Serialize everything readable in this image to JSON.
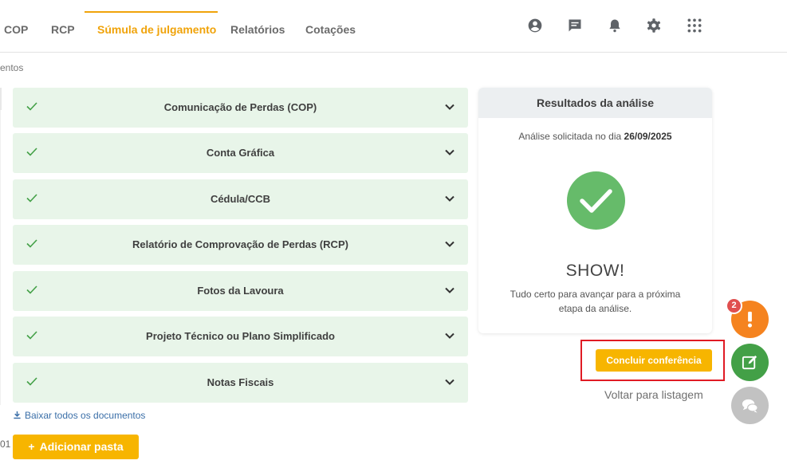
{
  "nav": {
    "tabs": [
      {
        "label": "COP"
      },
      {
        "label": "RCP"
      },
      {
        "label": "Súmula de julgamento",
        "active": true
      },
      {
        "label": "Relatórios"
      },
      {
        "label": "Cotações"
      }
    ],
    "icons": [
      "account-circle-icon",
      "chat-icon",
      "bell-icon",
      "gear-icon",
      "apps-grid-icon"
    ],
    "accent_color": "#f0a30a"
  },
  "breadcrumb": "entos",
  "documents": {
    "items": [
      {
        "label": "Comunicação de Perdas (COP)",
        "status": "ok"
      },
      {
        "label": "Conta Gráfica",
        "status": "ok"
      },
      {
        "label": "Cédula/CCB",
        "status": "ok"
      },
      {
        "label": "Relatório de Comprovação de Perdas (RCP)",
        "status": "ok"
      },
      {
        "label": "Fotos da Lavoura",
        "status": "ok"
      },
      {
        "label": "Projeto Técnico ou Plano Simplificado",
        "status": "ok"
      },
      {
        "label": "Notas Fiscais",
        "status": "ok"
      }
    ],
    "row_color": "#e8f5e9",
    "check_color": "#43a047",
    "download_all": "Baixar todos os documentos",
    "cut_number": "01",
    "add_folder": "Adicionar pasta"
  },
  "results": {
    "header": "Resultados da análise",
    "date_prefix": "Análise solicitada no dia",
    "date": "26/09/2025",
    "title": "SHOW!",
    "description": "Tudo certo para avançar para a próxima etapa da análise.",
    "success_color": "#66bb6a"
  },
  "actions": {
    "conclude": "Concluir conferência",
    "back": "Voltar para listagem",
    "button_color": "#f7b500",
    "highlight_color": "#e01b24"
  },
  "fabs": {
    "alert_badge": "2",
    "alert_icon": "exclamation-icon",
    "edit_icon": "edit-note-icon",
    "chat_icon": "chat-bubbles-icon"
  }
}
